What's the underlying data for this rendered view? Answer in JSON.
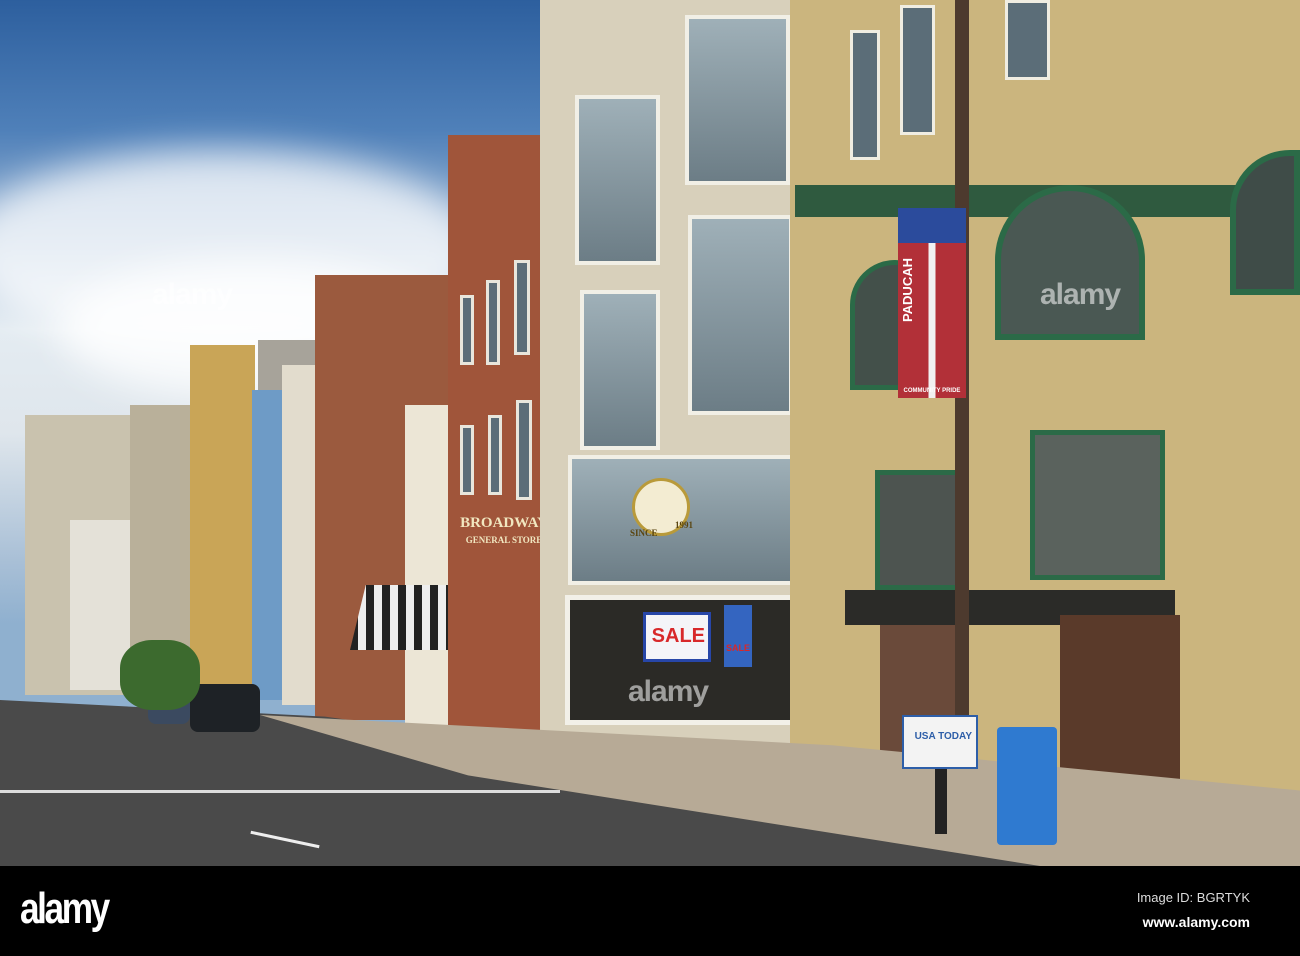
{
  "signs": {
    "banner_city": "PADUCAH",
    "banner_sub": "COMMUNITY PRIDE",
    "store_name": "BROADWAY",
    "store_sub": "GENERAL STORE",
    "sale_banner": "SALE",
    "sale_poster": "SALE",
    "plaque_since": "SINCE",
    "plaque_year": "1991",
    "news_box": "USA TODAY"
  },
  "watermarks": [
    "alamy",
    "alamy",
    "alamy"
  ],
  "footer": {
    "logo": "alamy",
    "image_id": "Image ID: BGRTYK",
    "url": "www.alamy.com"
  }
}
